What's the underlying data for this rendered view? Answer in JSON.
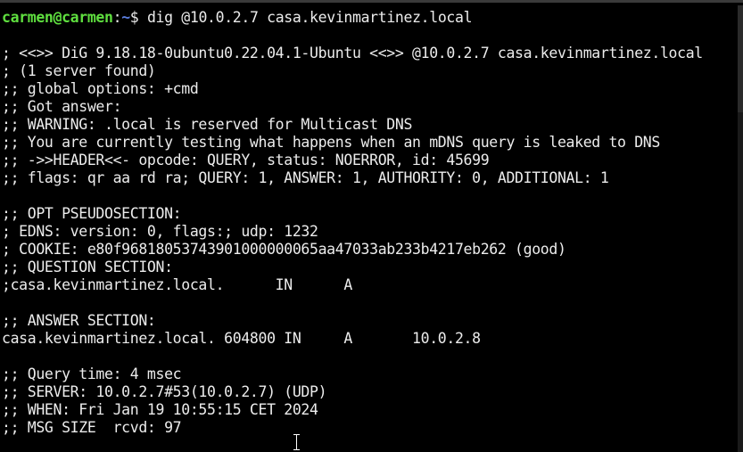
{
  "prompt": {
    "user_host": "carmen@carmen",
    "separator": ":",
    "path": "~",
    "symbol": "$",
    "command": "dig @10.0.2.7 casa.kevinmartinez.local"
  },
  "output_lines": [
    "",
    "; <<>> DiG 9.18.18-0ubuntu0.22.04.1-Ubuntu <<>> @10.0.2.7 casa.kevinmartinez.local",
    "; (1 server found)",
    ";; global options: +cmd",
    ";; Got answer:",
    ";; WARNING: .local is reserved for Multicast DNS",
    ";; You are currently testing what happens when an mDNS query is leaked to DNS",
    ";; ->>HEADER<<- opcode: QUERY, status: NOERROR, id: 45699",
    ";; flags: qr aa rd ra; QUERY: 1, ANSWER: 1, AUTHORITY: 0, ADDITIONAL: 1",
    "",
    ";; OPT PSEUDOSECTION:",
    "; EDNS: version: 0, flags:; udp: 1232",
    "; COOKIE: e80f96818053743901000000065aa47033ab233b4217eb262 (good)",
    ";; QUESTION SECTION:",
    ";casa.kevinmartinez.local.      IN      A",
    "",
    ";; ANSWER SECTION:",
    "casa.kevinmartinez.local. 604800 IN     A       10.0.2.8",
    "",
    ";; Query time: 4 msec",
    ";; SERVER: 10.0.2.7#53(10.0.2.7) (UDP)",
    ";; WHEN: Fri Jan 19 10:55:15 CET 2024",
    ";; MSG SIZE  rcvd: 97"
  ],
  "colors": {
    "background": "#000000",
    "text": "#ececec",
    "user_host": "#5fdf3f",
    "path": "#5c7fe0"
  }
}
